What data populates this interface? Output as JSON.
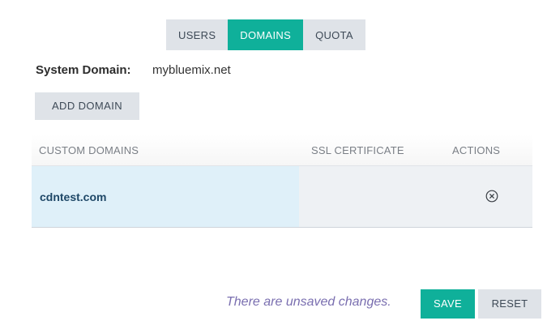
{
  "tabs": [
    {
      "label": "USERS",
      "active": false
    },
    {
      "label": "DOMAINS",
      "active": true
    },
    {
      "label": "QUOTA",
      "active": false
    }
  ],
  "system_domain": {
    "label": "System Domain:",
    "value": "mybluemix.net"
  },
  "add_domain_label": "ADD DOMAIN",
  "table": {
    "headers": {
      "custom_domains": "CUSTOM DOMAINS",
      "ssl_certificate": "SSL CERTIFICATE",
      "actions": "ACTIONS"
    },
    "rows": [
      {
        "domain": "cdntest.com",
        "ssl_certificate": "",
        "action_icon": "remove-circle-icon"
      }
    ]
  },
  "footer": {
    "unsaved_message": "There are unsaved changes.",
    "save_label": "SAVE",
    "reset_label": "RESET"
  },
  "colors": {
    "accent": "#0fb09a",
    "button_gray": "#dfe3e8",
    "selected_row": "#dff0f9",
    "row_bg": "#eef1f4",
    "unsaved_text": "#7a6fb0",
    "domain_text": "#1e4767"
  }
}
